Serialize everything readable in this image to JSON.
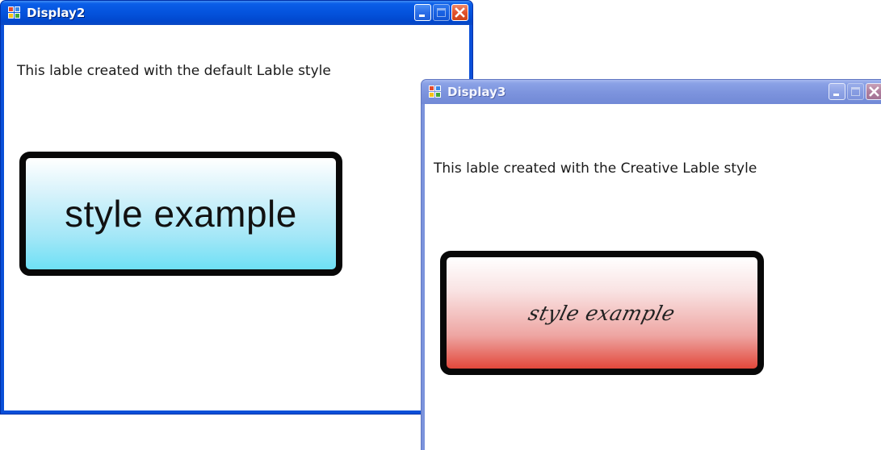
{
  "windows": {
    "display2": {
      "title": "Display2",
      "caption": "This lable created with the default Lable style",
      "label_text": "style example",
      "label_gradient": [
        "#ffffff",
        "#6ee0f5"
      ],
      "titlebar_color": "#0453dd",
      "icons": {
        "app": "application-icon",
        "minimize": "minimize-icon",
        "maximize": "maximize-icon",
        "close": "close-icon"
      }
    },
    "display3": {
      "title": "Display3",
      "caption": "This lable created with the Creative Lable style",
      "label_text": "style example",
      "label_gradient": [
        "#ffffff",
        "#e2483b"
      ],
      "titlebar_color": "#7c93dd",
      "state": "inactive",
      "icons": {
        "app": "application-icon",
        "minimize": "minimize-icon",
        "maximize": "maximize-icon",
        "close": "close-icon"
      }
    }
  }
}
